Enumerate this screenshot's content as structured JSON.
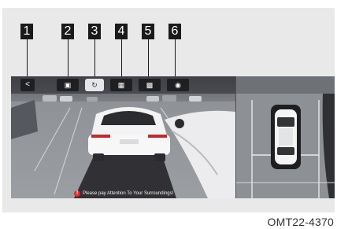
{
  "callouts": [
    "1",
    "2",
    "3",
    "4",
    "5",
    "6"
  ],
  "toolbar": {
    "back_label": "<",
    "buttons": [
      {
        "name": "front-camera-icon"
      },
      {
        "name": "rotate-3d-icon"
      },
      {
        "name": "view-mode-icon"
      },
      {
        "name": "side-camera-icon"
      },
      {
        "name": "settings-icon"
      }
    ]
  },
  "warning": {
    "icon": "!",
    "text": "Please pay Attention To Your Surroundings!"
  },
  "caption": "OMT22-4370",
  "colors": {
    "callout_bg": "#1a1a1a",
    "screen_bg": "#4a4c52",
    "warning_red": "#e02a2a"
  }
}
